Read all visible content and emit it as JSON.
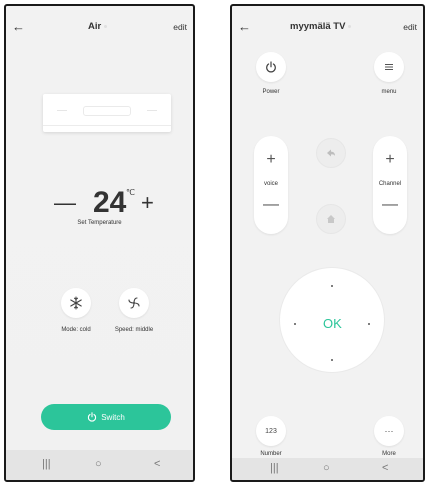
{
  "left": {
    "header": {
      "title": "Air",
      "edit": "edit"
    },
    "temperature": {
      "minus": "—",
      "value": "24",
      "unit": "℃",
      "plus": "+",
      "label": "Set Temperature"
    },
    "mode": {
      "label": "Mode: cold"
    },
    "speed": {
      "label": "Speed: middle"
    },
    "switch": {
      "label": "Switch"
    },
    "nav": {
      "recents": "|||",
      "home": "○",
      "back": "<"
    },
    "accent": "#2cc59a"
  },
  "right": {
    "header": {
      "title": "myymälä TV",
      "edit": "edit"
    },
    "power": {
      "label": "Power"
    },
    "menu": {
      "label": "menu"
    },
    "voice": {
      "label": "voice",
      "plus": "+",
      "minus": "—"
    },
    "channel": {
      "label": "Channel",
      "plus": "+",
      "minus": "—"
    },
    "ok": {
      "label": "OK"
    },
    "number": {
      "label": "Number",
      "text": "123"
    },
    "more": {
      "label": "More",
      "text": "···"
    },
    "nav": {
      "recents": "|||",
      "home": "○",
      "back": "<"
    }
  }
}
